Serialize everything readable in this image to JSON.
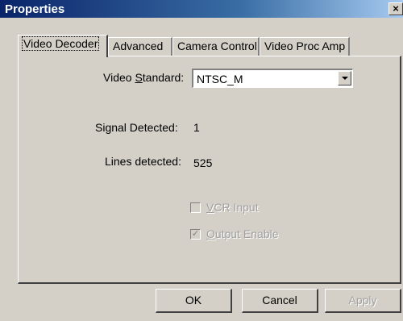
{
  "window": {
    "title": "Properties",
    "close_label": "×"
  },
  "tabs": [
    {
      "label": "Video Decoder",
      "active": true
    },
    {
      "label": "Advanced"
    },
    {
      "label": "Camera Control"
    },
    {
      "label": "Video Proc Amp"
    }
  ],
  "video_standard": {
    "label_pre": "Video ",
    "label_u": "S",
    "label_post": "tandard:",
    "value": "NTSC_M"
  },
  "signal_detected": {
    "label": "Signal Detected:",
    "value": "1"
  },
  "lines_detected": {
    "label": "Lines detected:",
    "value": "525"
  },
  "vcr_input": {
    "label_u": "V",
    "label_post": "CR Input",
    "checked": false,
    "enabled": false
  },
  "output_enable": {
    "label_u": "O",
    "label_post": "utput Enable",
    "checked": true,
    "enabled": false
  },
  "buttons": {
    "ok": "OK",
    "cancel": "Cancel",
    "apply": "Apply"
  }
}
